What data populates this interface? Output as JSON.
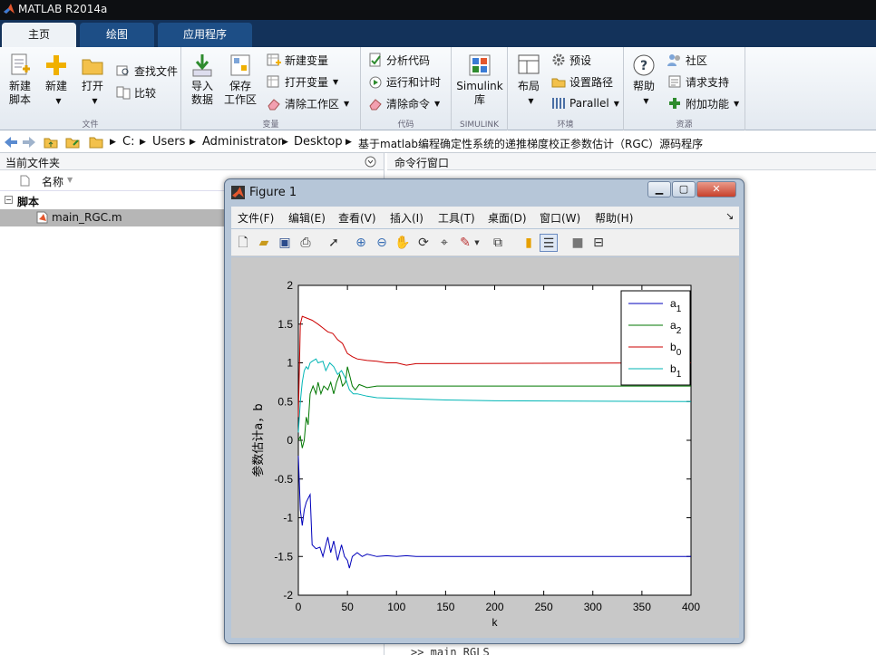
{
  "app": {
    "title": "MATLAB R2014a"
  },
  "tabs": [
    {
      "label": "主页"
    },
    {
      "label": "绘图"
    },
    {
      "label": "应用程序"
    }
  ],
  "ribbon": {
    "file": {
      "new_script": "新建\n脚本",
      "new": "新建",
      "open": "打开",
      "find_files": "查找文件",
      "compare": "比较",
      "label": "文件"
    },
    "variable": {
      "import": "导入\n数据",
      "save": "保存\n工作区",
      "new_var": "新建变量",
      "open_var": "打开变量",
      "clear_ws": "清除工作区",
      "label": "变量"
    },
    "code": {
      "analyze": "分析代码",
      "run_time": "运行和计时",
      "clear_cmd": "清除命令",
      "label": "代码"
    },
    "simulink": {
      "lib": "Simulink\n库",
      "label": "SIMULINK"
    },
    "env": {
      "layout": "布局",
      "prefs": "预设",
      "set_path": "设置路径",
      "parallel": "Parallel",
      "label": "环境"
    },
    "resources": {
      "help": "帮助",
      "community": "社区",
      "support": "请求支持",
      "addons": "附加功能",
      "label": "资源"
    }
  },
  "address": {
    "segments": [
      "C:",
      "Users",
      "Administrator",
      "Desktop",
      "基于matlab编程确定性系统的递推梯度校正参数估计（RGC）源码程序"
    ]
  },
  "current_folder": {
    "title": "当前文件夹",
    "col_name": "名称",
    "group": "脚本",
    "file": "main_RGC.m"
  },
  "command_window": {
    "title": "命令行窗口",
    "last_line": ">> main_RGLS"
  },
  "figure": {
    "title": "Figure 1",
    "menu": [
      "文件(F)",
      "编辑(E)",
      "查看(V)",
      "插入(I)",
      "工具(T)",
      "桌面(D)",
      "窗口(W)",
      "帮助(H)"
    ]
  },
  "chart_data": {
    "type": "line",
    "xlabel": "k",
    "ylabel": "参数估计a，b",
    "xlim": [
      0,
      400
    ],
    "ylim": [
      -2,
      2
    ],
    "xticks": [
      0,
      50,
      100,
      150,
      200,
      250,
      300,
      350,
      400
    ],
    "yticks": [
      -2,
      -1.5,
      -1,
      -0.5,
      0,
      0.5,
      1,
      1.5,
      2
    ],
    "legend_position": "top-right",
    "series": [
      {
        "name": "a1",
        "color": "#0000bb",
        "points": [
          [
            0,
            -0.2
          ],
          [
            2,
            -0.9
          ],
          [
            4,
            -1.1
          ],
          [
            6,
            -0.9
          ],
          [
            8,
            -0.8
          ],
          [
            10,
            -0.75
          ],
          [
            12,
            -0.7
          ],
          [
            14,
            -1.35
          ],
          [
            18,
            -1.4
          ],
          [
            22,
            -1.38
          ],
          [
            25,
            -1.5
          ],
          [
            28,
            -1.35
          ],
          [
            30,
            -1.25
          ],
          [
            33,
            -1.45
          ],
          [
            36,
            -1.3
          ],
          [
            40,
            -1.55
          ],
          [
            44,
            -1.35
          ],
          [
            47,
            -1.5
          ],
          [
            50,
            -1.55
          ],
          [
            52,
            -1.65
          ],
          [
            55,
            -1.5
          ],
          [
            60,
            -1.45
          ],
          [
            65,
            -1.5
          ],
          [
            70,
            -1.47
          ],
          [
            80,
            -1.5
          ],
          [
            90,
            -1.49
          ],
          [
            100,
            -1.5
          ],
          [
            110,
            -1.49
          ],
          [
            120,
            -1.5
          ],
          [
            400,
            -1.5
          ]
        ]
      },
      {
        "name": "a2",
        "color": "#007700",
        "points": [
          [
            0,
            0
          ],
          [
            2,
            0.05
          ],
          [
            4,
            -0.1
          ],
          [
            6,
            0
          ],
          [
            8,
            0.3
          ],
          [
            10,
            0.2
          ],
          [
            12,
            0.6
          ],
          [
            15,
            0.7
          ],
          [
            18,
            0.6
          ],
          [
            20,
            0.75
          ],
          [
            23,
            0.6
          ],
          [
            26,
            0.7
          ],
          [
            30,
            0.65
          ],
          [
            33,
            0.75
          ],
          [
            36,
            0.6
          ],
          [
            39,
            0.75
          ],
          [
            42,
            0.85
          ],
          [
            45,
            0.7
          ],
          [
            48,
            0.75
          ],
          [
            50,
            0.95
          ],
          [
            52,
            0.85
          ],
          [
            55,
            0.7
          ],
          [
            58,
            0.65
          ],
          [
            62,
            0.72
          ],
          [
            70,
            0.68
          ],
          [
            80,
            0.7
          ],
          [
            100,
            0.7
          ],
          [
            400,
            0.7
          ]
        ]
      },
      {
        "name": "b0",
        "color": "#cc0000",
        "points": [
          [
            0,
            0.3
          ],
          [
            2,
            1.5
          ],
          [
            4,
            1.6
          ],
          [
            8,
            1.58
          ],
          [
            14,
            1.55
          ],
          [
            20,
            1.5
          ],
          [
            25,
            1.45
          ],
          [
            30,
            1.4
          ],
          [
            35,
            1.38
          ],
          [
            40,
            1.3
          ],
          [
            45,
            1.25
          ],
          [
            50,
            1.12
          ],
          [
            55,
            1.08
          ],
          [
            60,
            1.05
          ],
          [
            70,
            1.03
          ],
          [
            80,
            1.02
          ],
          [
            90,
            1.0
          ],
          [
            100,
            1.0
          ],
          [
            110,
            0.97
          ],
          [
            120,
            0.99
          ],
          [
            400,
            1.0
          ]
        ]
      },
      {
        "name": "b1",
        "color": "#00b5b5",
        "points": [
          [
            0,
            0.1
          ],
          [
            2,
            0.5
          ],
          [
            4,
            0.75
          ],
          [
            6,
            0.9
          ],
          [
            8,
            0.95
          ],
          [
            10,
            0.92
          ],
          [
            12,
            1.0
          ],
          [
            14,
            1.02
          ],
          [
            18,
            1.05
          ],
          [
            20,
            1.0
          ],
          [
            25,
            1.02
          ],
          [
            28,
            0.9
          ],
          [
            32,
            1.0
          ],
          [
            36,
            0.95
          ],
          [
            40,
            0.85
          ],
          [
            44,
            0.9
          ],
          [
            48,
            0.8
          ],
          [
            52,
            0.65
          ],
          [
            56,
            0.6
          ],
          [
            60,
            0.6
          ],
          [
            70,
            0.57
          ],
          [
            80,
            0.55
          ],
          [
            100,
            0.54
          ],
          [
            150,
            0.52
          ],
          [
            200,
            0.51
          ],
          [
            400,
            0.5
          ]
        ]
      }
    ]
  }
}
